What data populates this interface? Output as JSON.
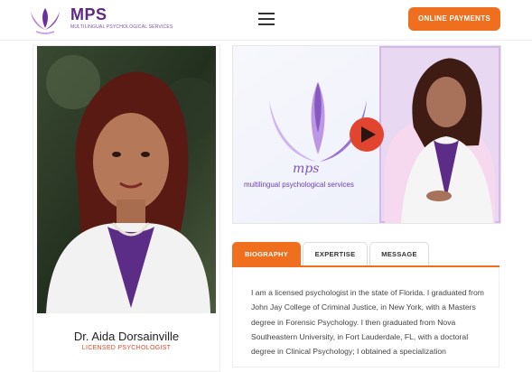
{
  "header": {
    "brand_name": "MPS",
    "brand_subtitle": "MULTILINGUAL PSYCHOLOGICAL SERVICES",
    "online_payments_label": "ONLINE PAYMENTS"
  },
  "profile": {
    "name": "Dr. Aida Dorsainville",
    "title": "LICENSED PSYCHOLOGIST"
  },
  "video": {
    "logo_text": "mps",
    "caption": "multilingual psychological services"
  },
  "tabs": [
    {
      "label": "BIOGRAPHY",
      "active": true
    },
    {
      "label": "EXPERTISE",
      "active": false
    },
    {
      "label": "MESSAGE",
      "active": false
    }
  ],
  "biography": {
    "text": "I am a licensed psychologist in the state of Florida. I graduated from John Jay College of Criminal Justice, in New York, with a Masters degree in Forensic Psychology. I then graduated from Nova Southeastern University, in Fort Lauderdale, FL, with a doctoral degree in Clinical Psychology; I obtained a specialization"
  },
  "colors": {
    "brand_purple": "#5c2a86",
    "accent_orange": "#f06f1f",
    "title_red": "#e04a2a",
    "play_button_red": "#e2452f"
  },
  "icons": {
    "logo": "hands-butterfly-logo-icon",
    "menu": "hamburger-menu-icon",
    "play": "play-icon"
  }
}
